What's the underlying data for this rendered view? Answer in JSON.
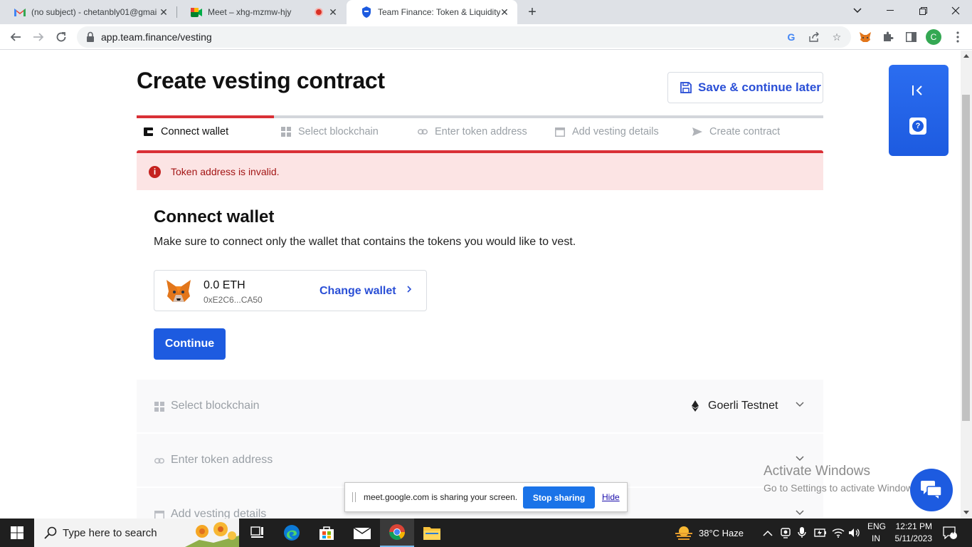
{
  "browser": {
    "tabs": [
      {
        "title": "(no subject) - chetanbly01@gmail",
        "icon": "gmail-icon"
      },
      {
        "title": "Meet – xhg-mzmw-hjy",
        "icon": "meet-icon"
      },
      {
        "title": "Team Finance: Token & Liquidity",
        "icon": "team-finance-icon"
      }
    ],
    "url": "app.team.finance/vesting",
    "profile_initial": "C"
  },
  "page": {
    "title": "Create vesting contract",
    "save_label": "Save & continue later",
    "progress_fraction": 0.2,
    "steps": [
      {
        "label": "Connect wallet",
        "icon": "wallet-icon"
      },
      {
        "label": "Select blockchain",
        "icon": "grid-icon"
      },
      {
        "label": "Enter token address",
        "icon": "link-icon"
      },
      {
        "label": "Add vesting details",
        "icon": "calendar-icon"
      },
      {
        "label": "Create contract",
        "icon": "send-icon"
      }
    ],
    "alert": "Token address is invalid.",
    "card": {
      "title": "Connect wallet",
      "description": "Make sure to connect only the wallet that contains the tokens you would like to vest.",
      "wallet_balance": "0.0 ETH",
      "wallet_address": "0xE2C6...CA50",
      "change_wallet": "Change wallet",
      "continue": "Continue"
    },
    "sections": [
      {
        "title": "Select blockchain",
        "value": "Goerli Testnet"
      },
      {
        "title": "Enter token address"
      },
      {
        "title": "Add vesting details"
      }
    ]
  },
  "overlay": {
    "activate_line1": "Activate Windows",
    "activate_line2": "Go to Settings to activate Windows.",
    "share_text": "meet.google.com is sharing your screen.",
    "stop_sharing": "Stop sharing",
    "hide": "Hide"
  },
  "taskbar": {
    "search_placeholder": "Type here to search",
    "weather": "38°C  Haze",
    "lang_line1": "ENG",
    "lang_line2": "IN",
    "time": "12:21 PM",
    "date": "5/11/2023",
    "notification_count": "4"
  },
  "colors": {
    "accent": "#1d5be0",
    "error": "#d93036",
    "error_bg": "#fce4e4"
  }
}
